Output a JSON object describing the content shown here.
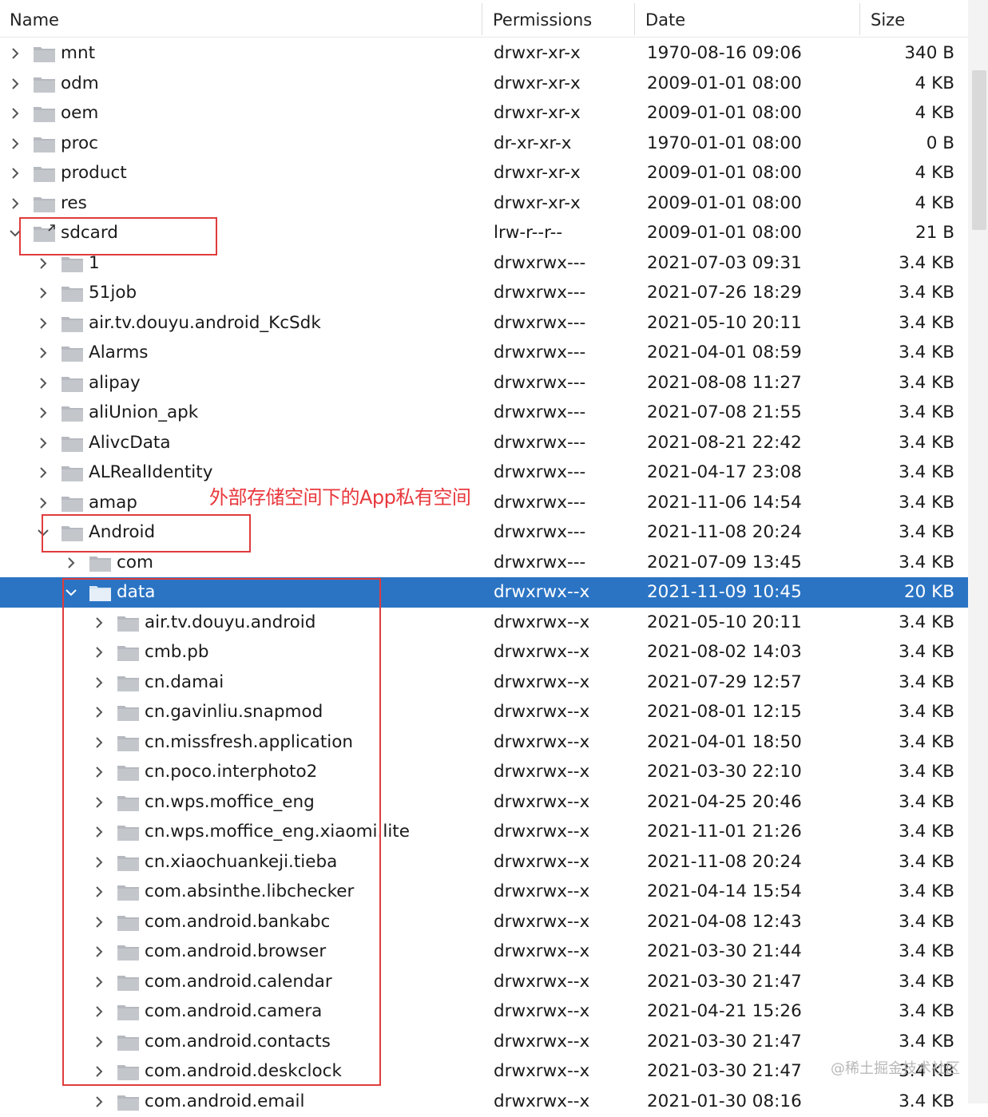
{
  "columns": {
    "name": "Name",
    "permissions": "Permissions",
    "date": "Date",
    "size": "Size"
  },
  "annotation": "外部存储空间下的App私有空间",
  "watermark": "@稀土掘金技术社区",
  "colors": {
    "selection": "#2b74c4",
    "highlight_box": "#e03c3c",
    "annotation_text": "#e8383d",
    "folder_icon": "#b5b9bf"
  },
  "rows": [
    {
      "name": "mnt",
      "permissions": "drwxr-xr-x",
      "date": "1970-08-16 09:06",
      "size": "340 B",
      "depth": 0,
      "expanded": false,
      "link": false
    },
    {
      "name": "odm",
      "permissions": "drwxr-xr-x",
      "date": "2009-01-01 08:00",
      "size": "4 KB",
      "depth": 0,
      "expanded": false,
      "link": false
    },
    {
      "name": "oem",
      "permissions": "drwxr-xr-x",
      "date": "2009-01-01 08:00",
      "size": "4 KB",
      "depth": 0,
      "expanded": false,
      "link": false
    },
    {
      "name": "proc",
      "permissions": "dr-xr-xr-x",
      "date": "1970-01-01 08:00",
      "size": "0 B",
      "depth": 0,
      "expanded": false,
      "link": false
    },
    {
      "name": "product",
      "permissions": "drwxr-xr-x",
      "date": "2009-01-01 08:00",
      "size": "4 KB",
      "depth": 0,
      "expanded": false,
      "link": false
    },
    {
      "name": "res",
      "permissions": "drwxr-xr-x",
      "date": "2009-01-01 08:00",
      "size": "4 KB",
      "depth": 0,
      "expanded": false,
      "link": false
    },
    {
      "name": "sdcard",
      "permissions": "lrw-r--r--",
      "date": "2009-01-01 08:00",
      "size": "21 B",
      "depth": 0,
      "expanded": true,
      "link": true
    },
    {
      "name": "1",
      "permissions": "drwxrwx---",
      "date": "2021-07-03 09:31",
      "size": "3.4 KB",
      "depth": 1,
      "expanded": false,
      "link": false
    },
    {
      "name": "51job",
      "permissions": "drwxrwx---",
      "date": "2021-07-26 18:29",
      "size": "3.4 KB",
      "depth": 1,
      "expanded": false,
      "link": false
    },
    {
      "name": "air.tv.douyu.android_KcSdk",
      "permissions": "drwxrwx---",
      "date": "2021-05-10 20:11",
      "size": "3.4 KB",
      "depth": 1,
      "expanded": false,
      "link": false
    },
    {
      "name": "Alarms",
      "permissions": "drwxrwx---",
      "date": "2021-04-01 08:59",
      "size": "3.4 KB",
      "depth": 1,
      "expanded": false,
      "link": false
    },
    {
      "name": "alipay",
      "permissions": "drwxrwx---",
      "date": "2021-08-08 11:27",
      "size": "3.4 KB",
      "depth": 1,
      "expanded": false,
      "link": false
    },
    {
      "name": "aliUnion_apk",
      "permissions": "drwxrwx---",
      "date": "2021-07-08 21:55",
      "size": "3.4 KB",
      "depth": 1,
      "expanded": false,
      "link": false
    },
    {
      "name": "AlivcData",
      "permissions": "drwxrwx---",
      "date": "2021-08-21 22:42",
      "size": "3.4 KB",
      "depth": 1,
      "expanded": false,
      "link": false
    },
    {
      "name": "ALRealIdentity",
      "permissions": "drwxrwx---",
      "date": "2021-04-17 23:08",
      "size": "3.4 KB",
      "depth": 1,
      "expanded": false,
      "link": false
    },
    {
      "name": "amap",
      "permissions": "drwxrwx---",
      "date": "2021-11-06 14:54",
      "size": "3.4 KB",
      "depth": 1,
      "expanded": false,
      "link": false
    },
    {
      "name": "Android",
      "permissions": "drwxrwx---",
      "date": "2021-11-08 20:24",
      "size": "3.4 KB",
      "depth": 1,
      "expanded": true,
      "link": false
    },
    {
      "name": "com",
      "permissions": "drwxrwx---",
      "date": "2021-07-09 13:45",
      "size": "3.4 KB",
      "depth": 2,
      "expanded": false,
      "link": false
    },
    {
      "name": "data",
      "permissions": "drwxrwx--x",
      "date": "2021-11-09 10:45",
      "size": "20 KB",
      "depth": 2,
      "expanded": true,
      "link": false,
      "selected": true
    },
    {
      "name": "air.tv.douyu.android",
      "permissions": "drwxrwx--x",
      "date": "2021-05-10 20:11",
      "size": "3.4 KB",
      "depth": 3,
      "expanded": false,
      "link": false
    },
    {
      "name": "cmb.pb",
      "permissions": "drwxrwx--x",
      "date": "2021-08-02 14:03",
      "size": "3.4 KB",
      "depth": 3,
      "expanded": false,
      "link": false
    },
    {
      "name": "cn.damai",
      "permissions": "drwxrwx--x",
      "date": "2021-07-29 12:57",
      "size": "3.4 KB",
      "depth": 3,
      "expanded": false,
      "link": false
    },
    {
      "name": "cn.gavinliu.snapmod",
      "permissions": "drwxrwx--x",
      "date": "2021-08-01 12:15",
      "size": "3.4 KB",
      "depth": 3,
      "expanded": false,
      "link": false
    },
    {
      "name": "cn.missfresh.application",
      "permissions": "drwxrwx--x",
      "date": "2021-04-01 18:50",
      "size": "3.4 KB",
      "depth": 3,
      "expanded": false,
      "link": false
    },
    {
      "name": "cn.poco.interphoto2",
      "permissions": "drwxrwx--x",
      "date": "2021-03-30 22:10",
      "size": "3.4 KB",
      "depth": 3,
      "expanded": false,
      "link": false
    },
    {
      "name": "cn.wps.moffice_eng",
      "permissions": "drwxrwx--x",
      "date": "2021-04-25 20:46",
      "size": "3.4 KB",
      "depth": 3,
      "expanded": false,
      "link": false
    },
    {
      "name": "cn.wps.moffice_eng.xiaomi.lite",
      "permissions": "drwxrwx--x",
      "date": "2021-11-01 21:26",
      "size": "3.4 KB",
      "depth": 3,
      "expanded": false,
      "link": false
    },
    {
      "name": "cn.xiaochuankeji.tieba",
      "permissions": "drwxrwx--x",
      "date": "2021-11-08 20:24",
      "size": "3.4 KB",
      "depth": 3,
      "expanded": false,
      "link": false
    },
    {
      "name": "com.absinthe.libchecker",
      "permissions": "drwxrwx--x",
      "date": "2021-04-14 15:54",
      "size": "3.4 KB",
      "depth": 3,
      "expanded": false,
      "link": false
    },
    {
      "name": "com.android.bankabc",
      "permissions": "drwxrwx--x",
      "date": "2021-04-08 12:43",
      "size": "3.4 KB",
      "depth": 3,
      "expanded": false,
      "link": false
    },
    {
      "name": "com.android.browser",
      "permissions": "drwxrwx--x",
      "date": "2021-03-30 21:44",
      "size": "3.4 KB",
      "depth": 3,
      "expanded": false,
      "link": false
    },
    {
      "name": "com.android.calendar",
      "permissions": "drwxrwx--x",
      "date": "2021-03-30 21:47",
      "size": "3.4 KB",
      "depth": 3,
      "expanded": false,
      "link": false
    },
    {
      "name": "com.android.camera",
      "permissions": "drwxrwx--x",
      "date": "2021-04-21 15:26",
      "size": "3.4 KB",
      "depth": 3,
      "expanded": false,
      "link": false
    },
    {
      "name": "com.android.contacts",
      "permissions": "drwxrwx--x",
      "date": "2021-03-30 21:47",
      "size": "3.4 KB",
      "depth": 3,
      "expanded": false,
      "link": false
    },
    {
      "name": "com.android.deskclock",
      "permissions": "drwxrwx--x",
      "date": "2021-03-30 21:47",
      "size": "3.4 KB",
      "depth": 3,
      "expanded": false,
      "link": false
    },
    {
      "name": "com.android.email",
      "permissions": "drwxrwx--x",
      "date": "2021-01-30 08:16",
      "size": "3.4 KB",
      "depth": 3,
      "expanded": false,
      "link": false
    }
  ]
}
